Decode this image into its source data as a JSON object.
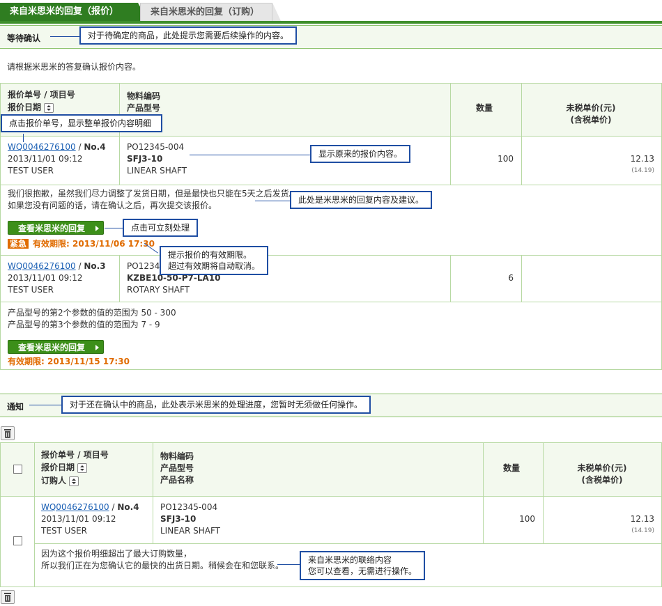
{
  "tabs": {
    "active": "来自米思米的回复（报价）",
    "inactive": "来自米思米的回复（订购）"
  },
  "pending": {
    "title": "等待确认",
    "intro": "请根据米思米的答复确认报价内容。",
    "headers": {
      "no": "报价单号 / 项目号",
      "date": "报价日期",
      "material": "物料编码",
      "model": "产品型号",
      "qty": "数量",
      "price1": "未税单价(元)",
      "price2": "(含税单价)"
    },
    "rows": [
      {
        "quote_no": "WQ0046276100",
        "item_no": "No.4",
        "datetime": "2013/11/01 09:12",
        "user": "TEST USER",
        "material": "PO12345-004",
        "model": "SFJ3-10",
        "name": "LINEAR SHAFT",
        "qty": "100",
        "price": "12.13",
        "price_tax": "(14.19)",
        "reply1": "我们很抱歉，虽然我们尽力调整了发货日期，但是最快也只能在5天之后发货。",
        "reply2": "如果您没有问题的话，请在确认之后，再次提交该报价。",
        "button": "查看米思米的回复",
        "urgent": "紧急",
        "deadline": "有效期限: 2013/11/06 17:30"
      },
      {
        "quote_no": "WQ0046276100",
        "item_no": "No.3",
        "datetime": "2013/11/01 09:12",
        "user": "TEST USER",
        "material": "PO12345-003",
        "model": "KZBE10-50-P7-LA10",
        "name": "ROTARY SHAFT",
        "qty": "6",
        "price": "",
        "price_tax": "",
        "reply1": "产品型号的第2个参数的值的范围为 50 - 300",
        "reply2": "产品型号的第3个参数的值的范围为 7 - 9",
        "button": "查看米思米的回复",
        "deadline": "有效期限: 2013/11/15 17:30"
      }
    ]
  },
  "notice": {
    "title": "通知",
    "headers": {
      "no": "报价单号 / 项目号",
      "date": "报价日期",
      "buyer": "订购人",
      "material": "物料编码",
      "model": "产品型号",
      "name": "产品名称",
      "qty": "数量",
      "price1": "未税单价(元)",
      "price2": "(含税单价)"
    },
    "row": {
      "quote_no": "WQ0046276100",
      "item_no": "No.4",
      "datetime": "2013/11/01 09:12",
      "user": "TEST USER",
      "material": "PO12345-004",
      "model": "SFJ3-10",
      "name": "LINEAR SHAFT",
      "qty": "100",
      "price": "12.13",
      "price_tax": "(14.19)",
      "msg1": "因为这个报价明细超出了最大订购数量，",
      "msg2": "所以我们正在为您确认它的最快的出货日期。稍候会在和您联系。"
    }
  },
  "callouts": {
    "c1": "对于待确定的商品，此处提示您需要后续操作的内容。",
    "c2": "点击报价单号，显示整单报价内容明细",
    "c3": "显示原来的报价内容。",
    "c4": "此处是米思米的回复内容及建议。",
    "c5": "点击可立刻处理",
    "c6a": "提示报价的有效期限。",
    "c6b": "超过有效期将自动取消。",
    "c7": "对于还在确认中的商品，此处表示米思米的处理进度，您暂时无须做任何操作。",
    "c8a": "来自米思米的联络内容",
    "c8b": "您可以查看，无需进行操作。"
  }
}
